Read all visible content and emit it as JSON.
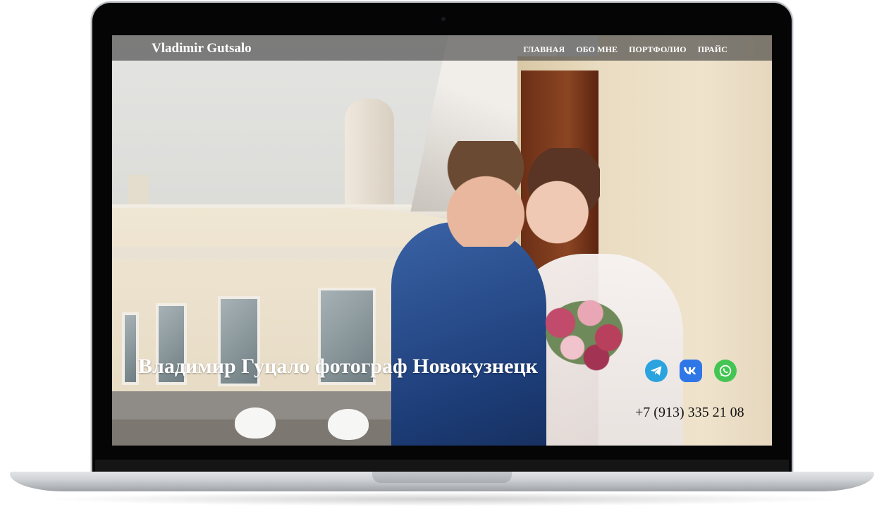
{
  "site": {
    "brand": "Vladimir Gutsalo",
    "nav": [
      "ГЛАВНАЯ",
      "ОБО МНЕ",
      "ПОРТФОЛИО",
      "ПРАЙС"
    ],
    "hero_title": "Владимир Гуцало фотограф Новокузнецк",
    "phone": "+7 (913) 335 21 08",
    "socials": [
      {
        "name": "telegram-icon",
        "color": "#2aa3df"
      },
      {
        "name": "vk-icon",
        "color": "#2f77e6"
      },
      {
        "name": "whatsapp-icon",
        "color": "#44c553"
      }
    ]
  },
  "colors": {
    "nav_bar": "rgba(60,60,60,0.62)",
    "text": "#ffffff",
    "phone_text": "#111111"
  }
}
